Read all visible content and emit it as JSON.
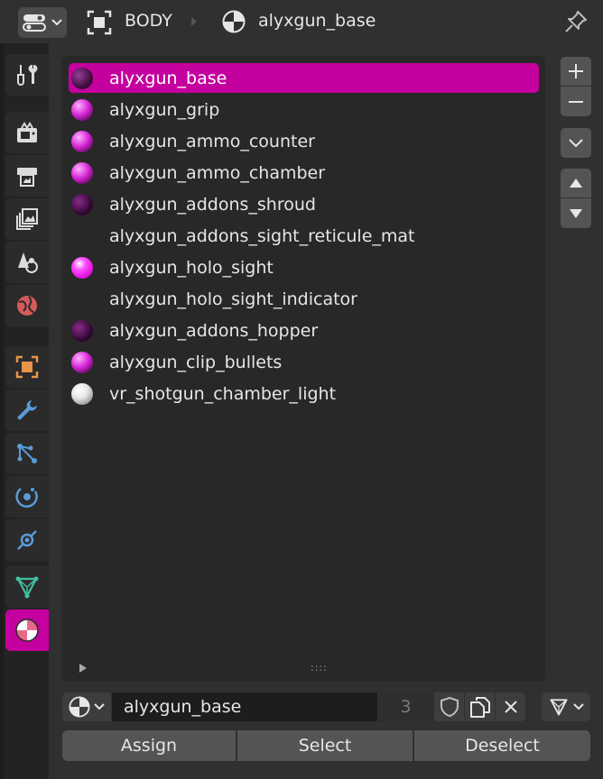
{
  "header": {
    "object_name": "BODY",
    "material_name": "alyxgun_base",
    "editor_type_icon": "properties-editor-icon",
    "object_icon": "object-data-icon",
    "material_icon": "material-icon",
    "pin_icon": "pin-icon"
  },
  "tabs": [
    {
      "name": "tool",
      "icon": "tool-icon"
    },
    {
      "name": "render",
      "icon": "render-icon"
    },
    {
      "name": "output",
      "icon": "output-icon"
    },
    {
      "name": "view-layer",
      "icon": "view-layer-icon"
    },
    {
      "name": "scene",
      "icon": "scene-icon"
    },
    {
      "name": "world",
      "icon": "world-icon"
    },
    {
      "name": "object",
      "icon": "object-icon"
    },
    {
      "name": "modifiers",
      "icon": "wrench-icon"
    },
    {
      "name": "particles",
      "icon": "particles-icon"
    },
    {
      "name": "physics",
      "icon": "physics-icon"
    },
    {
      "name": "constraints",
      "icon": "constraints-icon"
    },
    {
      "name": "data",
      "icon": "mesh-data-icon"
    },
    {
      "name": "material",
      "icon": "material-icon",
      "active": true
    }
  ],
  "material_slots": [
    {
      "label": "alyxgun_base",
      "active": true,
      "preview": "dark"
    },
    {
      "label": "alyxgun_grip",
      "preview": "magenta"
    },
    {
      "label": "alyxgun_ammo_counter",
      "preview": "magenta"
    },
    {
      "label": "alyxgun_ammo_chamber",
      "preview": "magenta"
    },
    {
      "label": "alyxgun_addons_shroud",
      "preview": "dark"
    },
    {
      "label": "alyxgun_addons_sight_reticule_mat",
      "preview": "none"
    },
    {
      "label": "alyxgun_holo_sight",
      "preview": "bright"
    },
    {
      "label": "alyxgun_holo_sight_indicator",
      "preview": "none"
    },
    {
      "label": "alyxgun_addons_hopper",
      "preview": "dark"
    },
    {
      "label": "alyxgun_clip_bullets",
      "preview": "magenta"
    },
    {
      "label": "vr_shotgun_chamber_light",
      "preview": "white"
    }
  ],
  "list_controls": {
    "add_label": "+",
    "remove_label": "−",
    "grip": "::::"
  },
  "datablock": {
    "name": "alyxgun_base",
    "users": "3"
  },
  "actions": {
    "assign": "Assign",
    "select": "Select",
    "deselect": "Deselect"
  },
  "colors": {
    "accent": "#c4009e",
    "panel_bg": "#303030",
    "list_bg": "#282828",
    "button_bg": "#545454"
  }
}
